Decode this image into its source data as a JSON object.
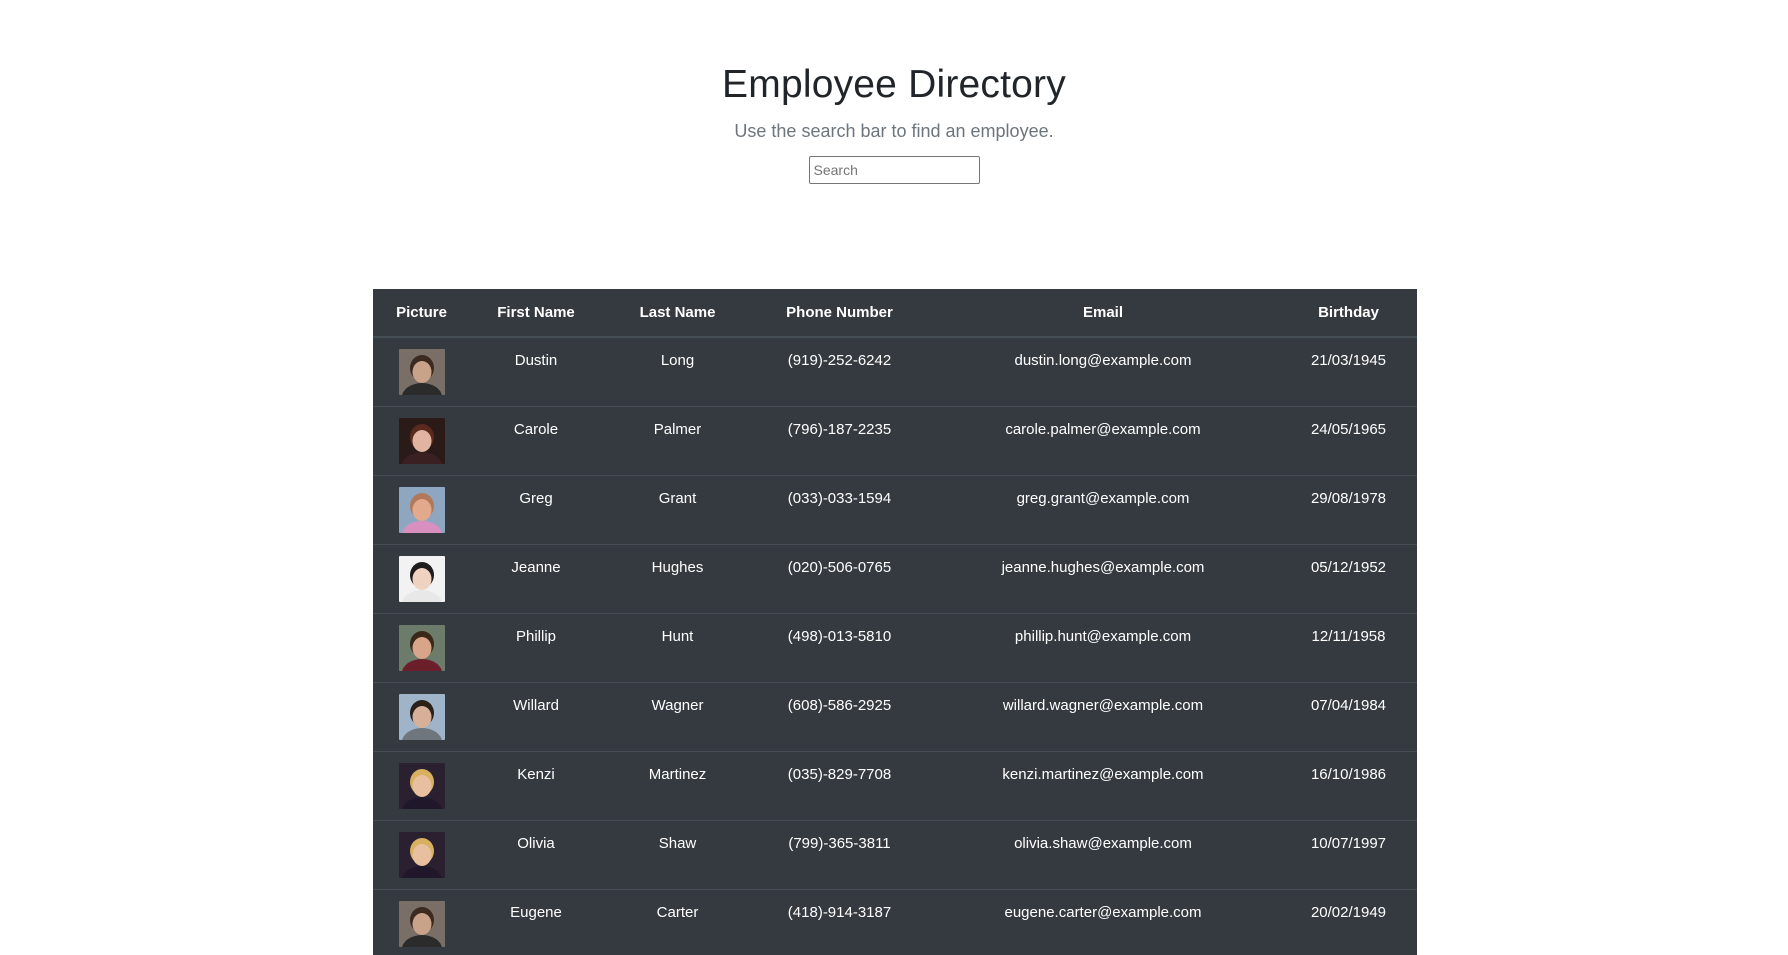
{
  "header": {
    "title": "Employee Directory",
    "subtitle": "Use the search bar to find an employee.",
    "search_placeholder": "Search",
    "search_value": ""
  },
  "table": {
    "columns": [
      "Picture",
      "First Name",
      "Last Name",
      "Phone Number",
      "Email",
      "Birthday"
    ],
    "rows": [
      {
        "first": "Dustin",
        "last": "Long",
        "phone": "(919)-252-6242",
        "email": "dustin.long@example.com",
        "birthday": "21/03/1945",
        "bg": "#7a6f66",
        "skin": "#c9a28a",
        "hair": "#3b2a20",
        "shirt": "#2b2b2b"
      },
      {
        "first": "Carole",
        "last": "Palmer",
        "phone": "(796)-187-2235",
        "email": "carole.palmer@example.com",
        "birthday": "24/05/1965",
        "bg": "#2a1a18",
        "skin": "#e0b4a0",
        "hair": "#5a2a1e",
        "shirt": "#3a2020"
      },
      {
        "first": "Greg",
        "last": "Grant",
        "phone": "(033)-033-1594",
        "email": "greg.grant@example.com",
        "birthday": "29/08/1978",
        "bg": "#8fa6c0",
        "skin": "#e3a98c",
        "hair": "#b07a5a",
        "shirt": "#d98fc0"
      },
      {
        "first": "Jeanne",
        "last": "Hughes",
        "phone": "(020)-506-0765",
        "email": "jeanne.hughes@example.com",
        "birthday": "05/12/1952",
        "bg": "#f2f2f2",
        "skin": "#f0d2c0",
        "hair": "#1d1d1d",
        "shirt": "#e8e8e8"
      },
      {
        "first": "Phillip",
        "last": "Hunt",
        "phone": "(498)-013-5810",
        "email": "phillip.hunt@example.com",
        "birthday": "12/11/1958",
        "bg": "#6d7b6a",
        "skin": "#d8a58a",
        "hair": "#3a2818",
        "shirt": "#6a1f2a"
      },
      {
        "first": "Willard",
        "last": "Wagner",
        "phone": "(608)-586-2925",
        "email": "willard.wagner@example.com",
        "birthday": "07/04/1984",
        "bg": "#9fb4c8",
        "skin": "#d8b09a",
        "hair": "#2a2018",
        "shirt": "#6f767d"
      },
      {
        "first": "Kenzi",
        "last": "Martinez",
        "phone": "(035)-829-7708",
        "email": "kenzi.martinez@example.com",
        "birthday": "16/10/1986",
        "bg": "#2a2030",
        "skin": "#e8c0a0",
        "hair": "#d8b060",
        "shirt": "#20182a"
      },
      {
        "first": "Olivia",
        "last": "Shaw",
        "phone": "(799)-365-3811",
        "email": "olivia.shaw@example.com",
        "birthday": "10/07/1997",
        "bg": "#2a2030",
        "skin": "#e8c0a0",
        "hair": "#d8b060",
        "shirt": "#20182a"
      },
      {
        "first": "Eugene",
        "last": "Carter",
        "phone": "(418)-914-3187",
        "email": "eugene.carter@example.com",
        "birthday": "20/02/1949",
        "bg": "#7a6f66",
        "skin": "#c9a28a",
        "hair": "#3b2a20",
        "shirt": "#2b2b2b"
      }
    ]
  }
}
